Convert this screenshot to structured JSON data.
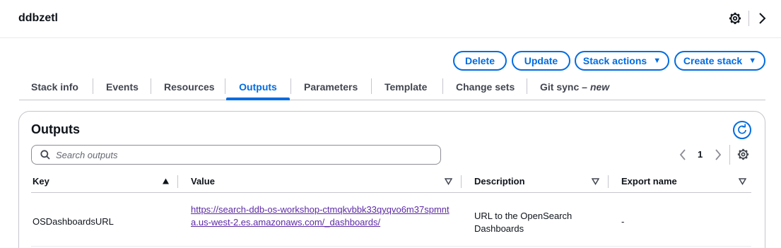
{
  "header": {
    "stack_name": "ddbzetl"
  },
  "actions": {
    "delete": "Delete",
    "update": "Update",
    "stack_actions": "Stack actions",
    "create_stack": "Create stack"
  },
  "tabs": [
    {
      "label": "Stack info"
    },
    {
      "label": "Events"
    },
    {
      "label": "Resources"
    },
    {
      "label": "Outputs"
    },
    {
      "label": "Parameters"
    },
    {
      "label": "Template"
    },
    {
      "label": "Change sets"
    },
    {
      "label": "Git sync",
      "badge": "new"
    }
  ],
  "active_tab": "Outputs",
  "outputs": {
    "title": "Outputs",
    "search_placeholder": "Search outputs",
    "page": "1",
    "columns": [
      "Key",
      "Value",
      "Description",
      "Export name"
    ],
    "rows": [
      {
        "key": "OSDashboardsURL",
        "value": "https://search-ddb-os-workshop-ctmqkvbbk33qyqvo6m37spmnta.us-west-2.es.amazonaws.com/_dashboards/",
        "description": "URL to the OpenSearch Dashboards",
        "export_name": "-"
      }
    ]
  },
  "colors": {
    "accent": "#006ce0",
    "link_visited": "#5d2ba5",
    "text": "#0f141a"
  }
}
